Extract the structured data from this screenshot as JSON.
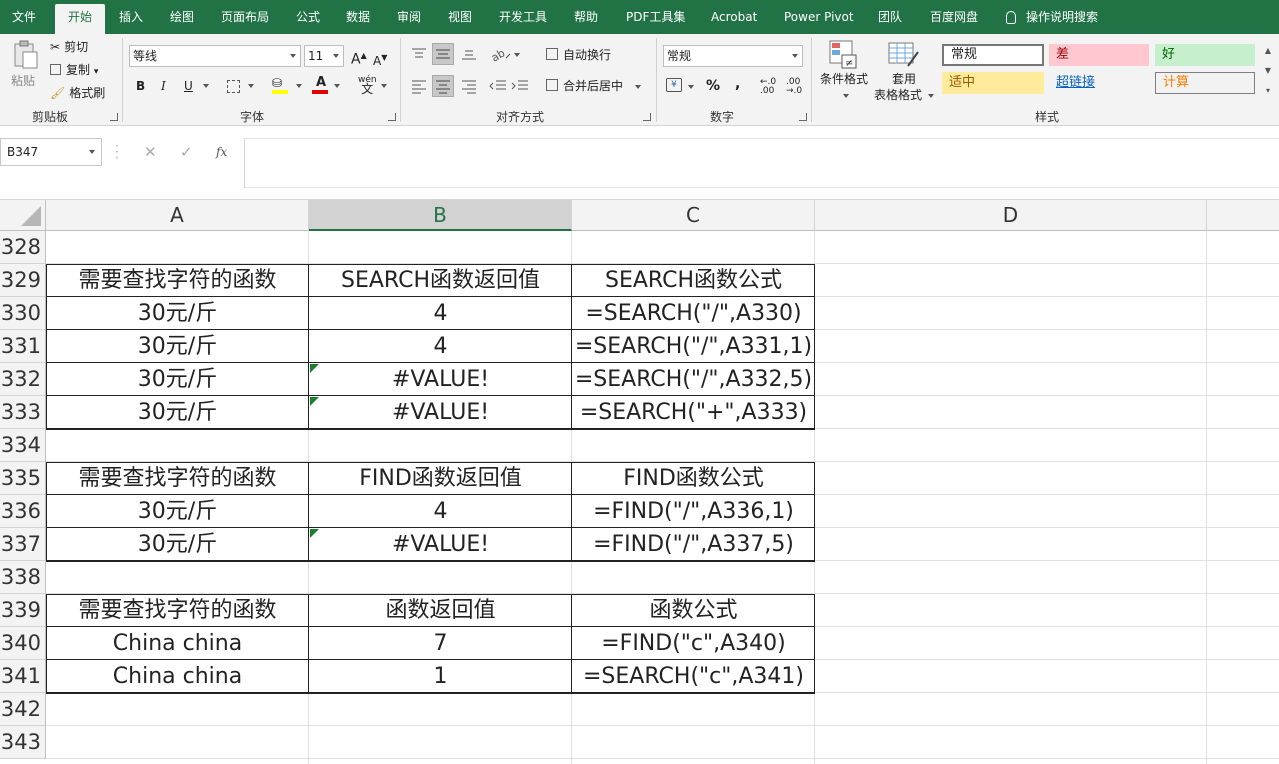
{
  "menu": {
    "tabs": [
      "文件",
      "开始",
      "插入",
      "绘图",
      "页面布局",
      "公式",
      "数据",
      "审阅",
      "视图",
      "开发工具",
      "帮助",
      "PDF工具集",
      "Acrobat",
      "Power Pivot",
      "团队",
      "百度网盘"
    ],
    "tell_me": "操作说明搜索",
    "active_tab": "开始"
  },
  "ribbon": {
    "clipboard": {
      "paste": "粘贴",
      "cut": "剪切",
      "copy": "复制",
      "format_painter": "格式刷",
      "label": "剪贴板"
    },
    "font": {
      "name": "等线",
      "size": "11",
      "bold": "B",
      "italic": "I",
      "underline": "U",
      "grow": "A",
      "shrink": "A",
      "label": "字体"
    },
    "alignment": {
      "wrap": "自动换行",
      "merge": "合并后居中",
      "label": "对齐方式"
    },
    "number": {
      "format": "常规",
      "percent": "%",
      "comma": ",",
      "inc_decimal": ".00",
      "dec_decimal": ".0",
      "label": "数字"
    },
    "styles": {
      "conditional": "条件格式",
      "table_fmt": "套用",
      "table_fmt2": "表格格式",
      "normal": "常规",
      "bad": "差",
      "good": "好",
      "neutral": "适中",
      "hyperlink": "超链接",
      "calc": "计算",
      "label": "样式"
    }
  },
  "formula_bar": {
    "name_box": "B347",
    "cancel": "✕",
    "enter": "✓",
    "fx": "fx",
    "content": ""
  },
  "colors": {
    "brand": "#217346",
    "bad_bg": "#ffc7ce",
    "bad_fg": "#9c0006",
    "good_bg": "#c6efce",
    "good_fg": "#006100",
    "neutral_bg": "#ffeb9c",
    "neutral_fg": "#9c5700",
    "calc_bg": "#f2f2f2",
    "calc_fg": "#fa7d00"
  },
  "columns": [
    "A",
    "B",
    "C",
    "D"
  ],
  "rows": [
    {
      "n": "328",
      "a": "",
      "b": "",
      "c": ""
    },
    {
      "n": "329",
      "a": "需要查找字符的函数",
      "b": "SEARCH函数返回值",
      "c": "SEARCH函数公式"
    },
    {
      "n": "330",
      "a": "30元/斤",
      "b": "4",
      "c": "=SEARCH(\"/\",A330)"
    },
    {
      "n": "331",
      "a": "30元/斤",
      "b": "4",
      "c": "=SEARCH(\"/\",A331,1)"
    },
    {
      "n": "332",
      "a": "30元/斤",
      "b": "#VALUE!",
      "c": "=SEARCH(\"/\",A332,5)"
    },
    {
      "n": "333",
      "a": "30元/斤",
      "b": "#VALUE!",
      "c": "=SEARCH(\"+\",A333)"
    },
    {
      "n": "334",
      "a": "",
      "b": "",
      "c": ""
    },
    {
      "n": "335",
      "a": "需要查找字符的函数",
      "b": "FIND函数返回值",
      "c": "FIND函数公式"
    },
    {
      "n": "336",
      "a": "30元/斤",
      "b": "4",
      "c": "=FIND(\"/\",A336,1)"
    },
    {
      "n": "337",
      "a": "30元/斤",
      "b": "#VALUE!",
      "c": "=FIND(\"/\",A337,5)"
    },
    {
      "n": "338",
      "a": "",
      "b": "",
      "c": ""
    },
    {
      "n": "339",
      "a": "需要查找字符的函数",
      "b": "函数返回值",
      "c": "函数公式"
    },
    {
      "n": "340",
      "a": "China china",
      "b": "7",
      "c": "=FIND(\"c\",A340)"
    },
    {
      "n": "341",
      "a": "China china",
      "b": "1",
      "c": "=SEARCH(\"c\",A341)"
    },
    {
      "n": "342",
      "a": "",
      "b": "",
      "c": ""
    },
    {
      "n": "343",
      "a": "",
      "b": "",
      "c": ""
    }
  ]
}
